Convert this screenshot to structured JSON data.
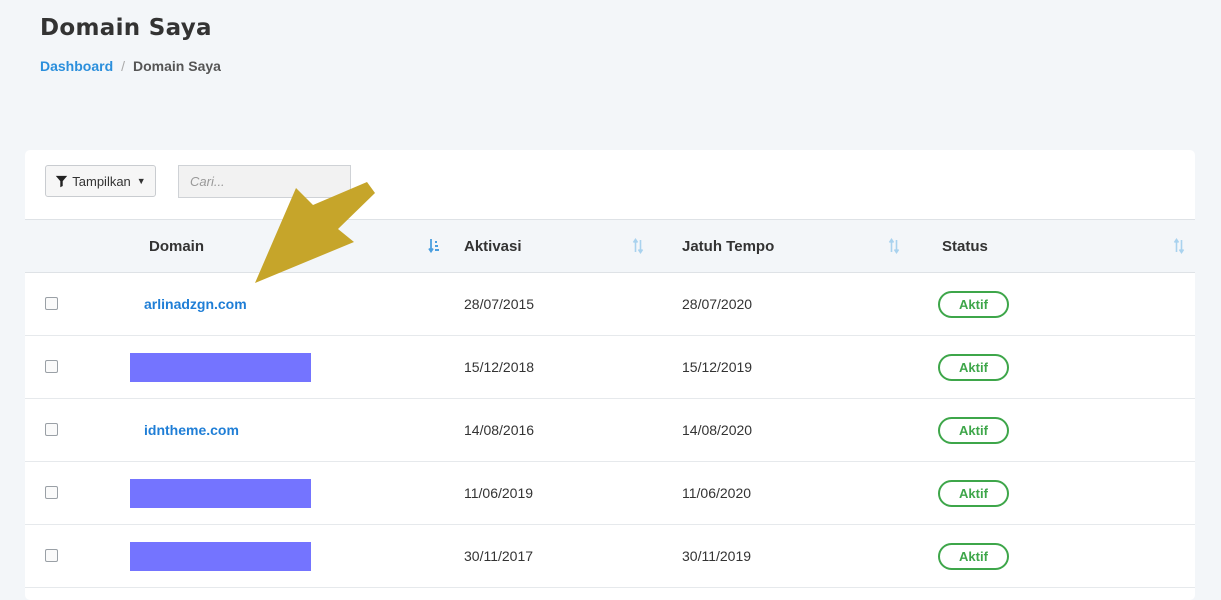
{
  "page": {
    "title": "Domain Saya"
  },
  "breadcrumb": {
    "home": "Dashboard",
    "current": "Domain Saya",
    "separator": "/"
  },
  "toolbar": {
    "filter_label": "Tampilkan",
    "search_placeholder": "Cari..."
  },
  "table": {
    "headers": {
      "domain": "Domain",
      "activation": "Aktivasi",
      "due": "Jatuh Tempo",
      "status": "Status"
    },
    "rows": [
      {
        "domain": "arlinadzgn.com",
        "redacted": false,
        "activation": "28/07/2015",
        "due": "28/07/2020",
        "status": "Aktif"
      },
      {
        "domain": "",
        "redacted": true,
        "activation": "15/12/2018",
        "due": "15/12/2019",
        "status": "Aktif"
      },
      {
        "domain": "idntheme.com",
        "redacted": false,
        "activation": "14/08/2016",
        "due": "14/08/2020",
        "status": "Aktif"
      },
      {
        "domain": "",
        "redacted": true,
        "activation": "11/06/2019",
        "due": "11/06/2020",
        "status": "Aktif"
      },
      {
        "domain": "",
        "redacted": true,
        "activation": "30/11/2017",
        "due": "30/11/2019",
        "status": "Aktif"
      }
    ]
  },
  "colors": {
    "accent": "#1f7ed6",
    "status_active": "#3ea64a",
    "redaction": "#7474ff",
    "annotation_arrow": "#c6a52a"
  },
  "icons": {
    "filter": "filter-icon",
    "sort": "sort-icon",
    "sort_active": "sort-ascending-icon"
  }
}
